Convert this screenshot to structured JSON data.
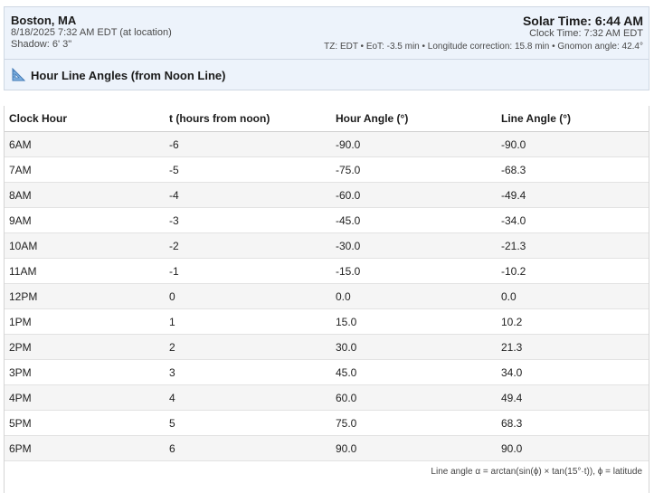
{
  "header": {
    "location": "Boston, MA",
    "datetime": "8/18/2025 7:32 AM EDT (at location)",
    "shadow": "Shadow: 6' 3\"",
    "solar_time": "Solar Time: 6:44 AM",
    "clock_time": "Clock Time: 7:32 AM EDT",
    "meta": "TZ: EDT • EoT: -3.5 min • Longitude correction: 15.8 min • Gnomon angle: 42.4°"
  },
  "section": {
    "icon": "triangle-ruler-icon",
    "title": "Hour Line Angles (from Noon Line)"
  },
  "table": {
    "headers": [
      "Clock Hour",
      "t (hours from noon)",
      "Hour Angle (°)",
      "Line Angle (°)"
    ],
    "rows": [
      [
        "6AM",
        "-6",
        "-90.0",
        "-90.0"
      ],
      [
        "7AM",
        "-5",
        "-75.0",
        "-68.3"
      ],
      [
        "8AM",
        "-4",
        "-60.0",
        "-49.4"
      ],
      [
        "9AM",
        "-3",
        "-45.0",
        "-34.0"
      ],
      [
        "10AM",
        "-2",
        "-30.0",
        "-21.3"
      ],
      [
        "11AM",
        "-1",
        "-15.0",
        "-10.2"
      ],
      [
        "12PM",
        "0",
        "0.0",
        "0.0"
      ],
      [
        "1PM",
        "1",
        "15.0",
        "10.2"
      ],
      [
        "2PM",
        "2",
        "30.0",
        "21.3"
      ],
      [
        "3PM",
        "3",
        "45.0",
        "34.0"
      ],
      [
        "4PM",
        "4",
        "60.0",
        "49.4"
      ],
      [
        "5PM",
        "5",
        "75.0",
        "68.3"
      ],
      [
        "6PM",
        "6",
        "90.0",
        "90.0"
      ]
    ],
    "footer": "Line angle α = arctan(sin(ϕ) × tan(15°·t)), ϕ = latitude"
  }
}
